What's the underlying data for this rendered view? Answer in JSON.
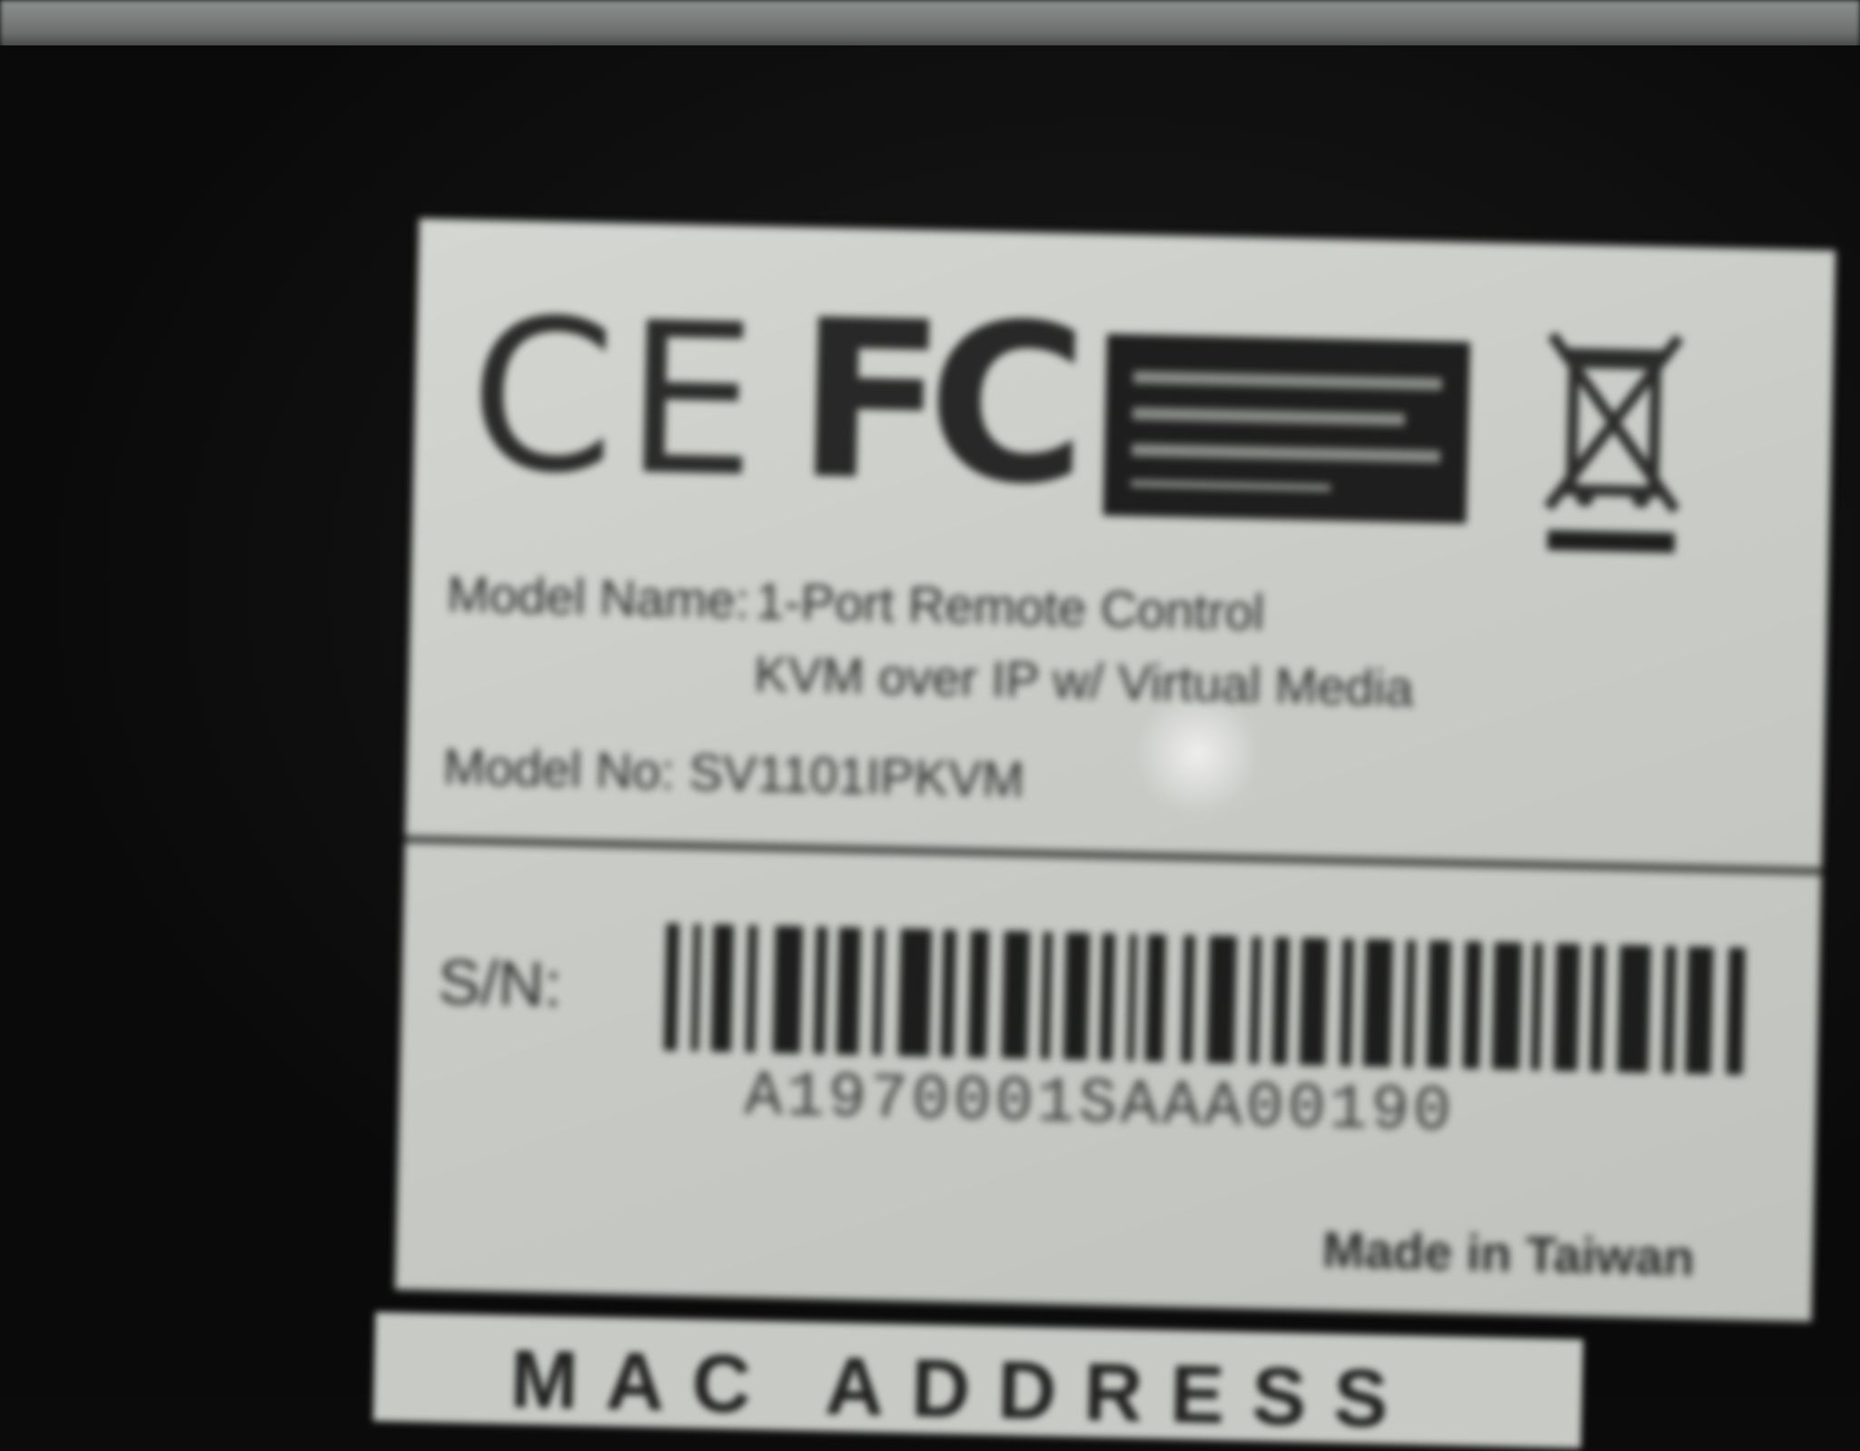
{
  "photo": {
    "description_role": "blurry photo of a product rating label",
    "colors": {
      "surface": "#0b0b0b",
      "label": "#cfd1cd",
      "ink": "#2a2b2a"
    }
  },
  "label": {
    "marks": {
      "ce": "CE",
      "fc": "FC",
      "weee_icon": "crossed-out-bin-icon"
    },
    "fields": {
      "model_name_label": "Model Name:",
      "model_name_line1": "1-Port Remote Control",
      "model_name_line2": "KVM over IP w/ Virtual Media",
      "model_no": "Model No: SV1101IPKVM"
    },
    "serial": {
      "label": "S/N:",
      "value": "A1970001SAAA00190"
    },
    "made_in": "Made in Taiwan"
  },
  "lower_label": {
    "text": "MAC ADDRESS"
  }
}
